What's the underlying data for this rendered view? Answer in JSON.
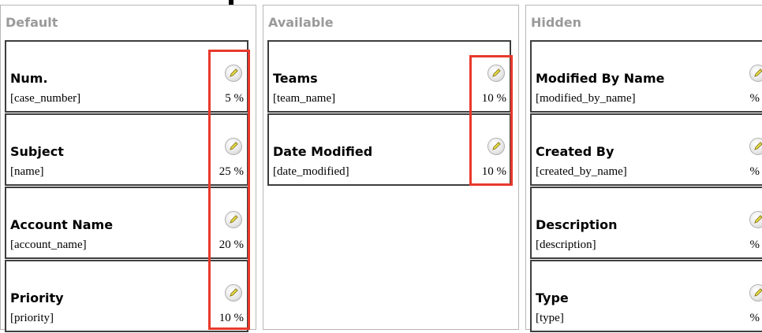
{
  "columns": [
    {
      "header": "Default",
      "fields": [
        {
          "title": "Num.",
          "key": "[case_number]",
          "width": "5 %"
        },
        {
          "title": "Subject",
          "key": "[name]",
          "width": "25 %"
        },
        {
          "title": "Account Name",
          "key": "[account_name]",
          "width": "20 %"
        },
        {
          "title": "Priority",
          "key": "[priority]",
          "width": "10 %"
        }
      ]
    },
    {
      "header": "Available",
      "fields": [
        {
          "title": "Teams",
          "key": "[team_name]",
          "width": "10 %"
        },
        {
          "title": "Date Modified",
          "key": "[date_modified]",
          "width": "10 %"
        }
      ]
    },
    {
      "header": "Hidden",
      "fields": [
        {
          "title": "Modified By Name",
          "key": "[modified_by_name]",
          "width": "%"
        },
        {
          "title": "Created By",
          "key": "[created_by_name]",
          "width": "%"
        },
        {
          "title": "Description",
          "key": "[description]",
          "width": "%"
        },
        {
          "title": "Type",
          "key": "[type]",
          "width": "%"
        }
      ]
    }
  ],
  "icons": {
    "edit": "pencil-edit-icon"
  },
  "colors": {
    "highlight": "#e8392b",
    "header_text": "#9a9a9a"
  }
}
